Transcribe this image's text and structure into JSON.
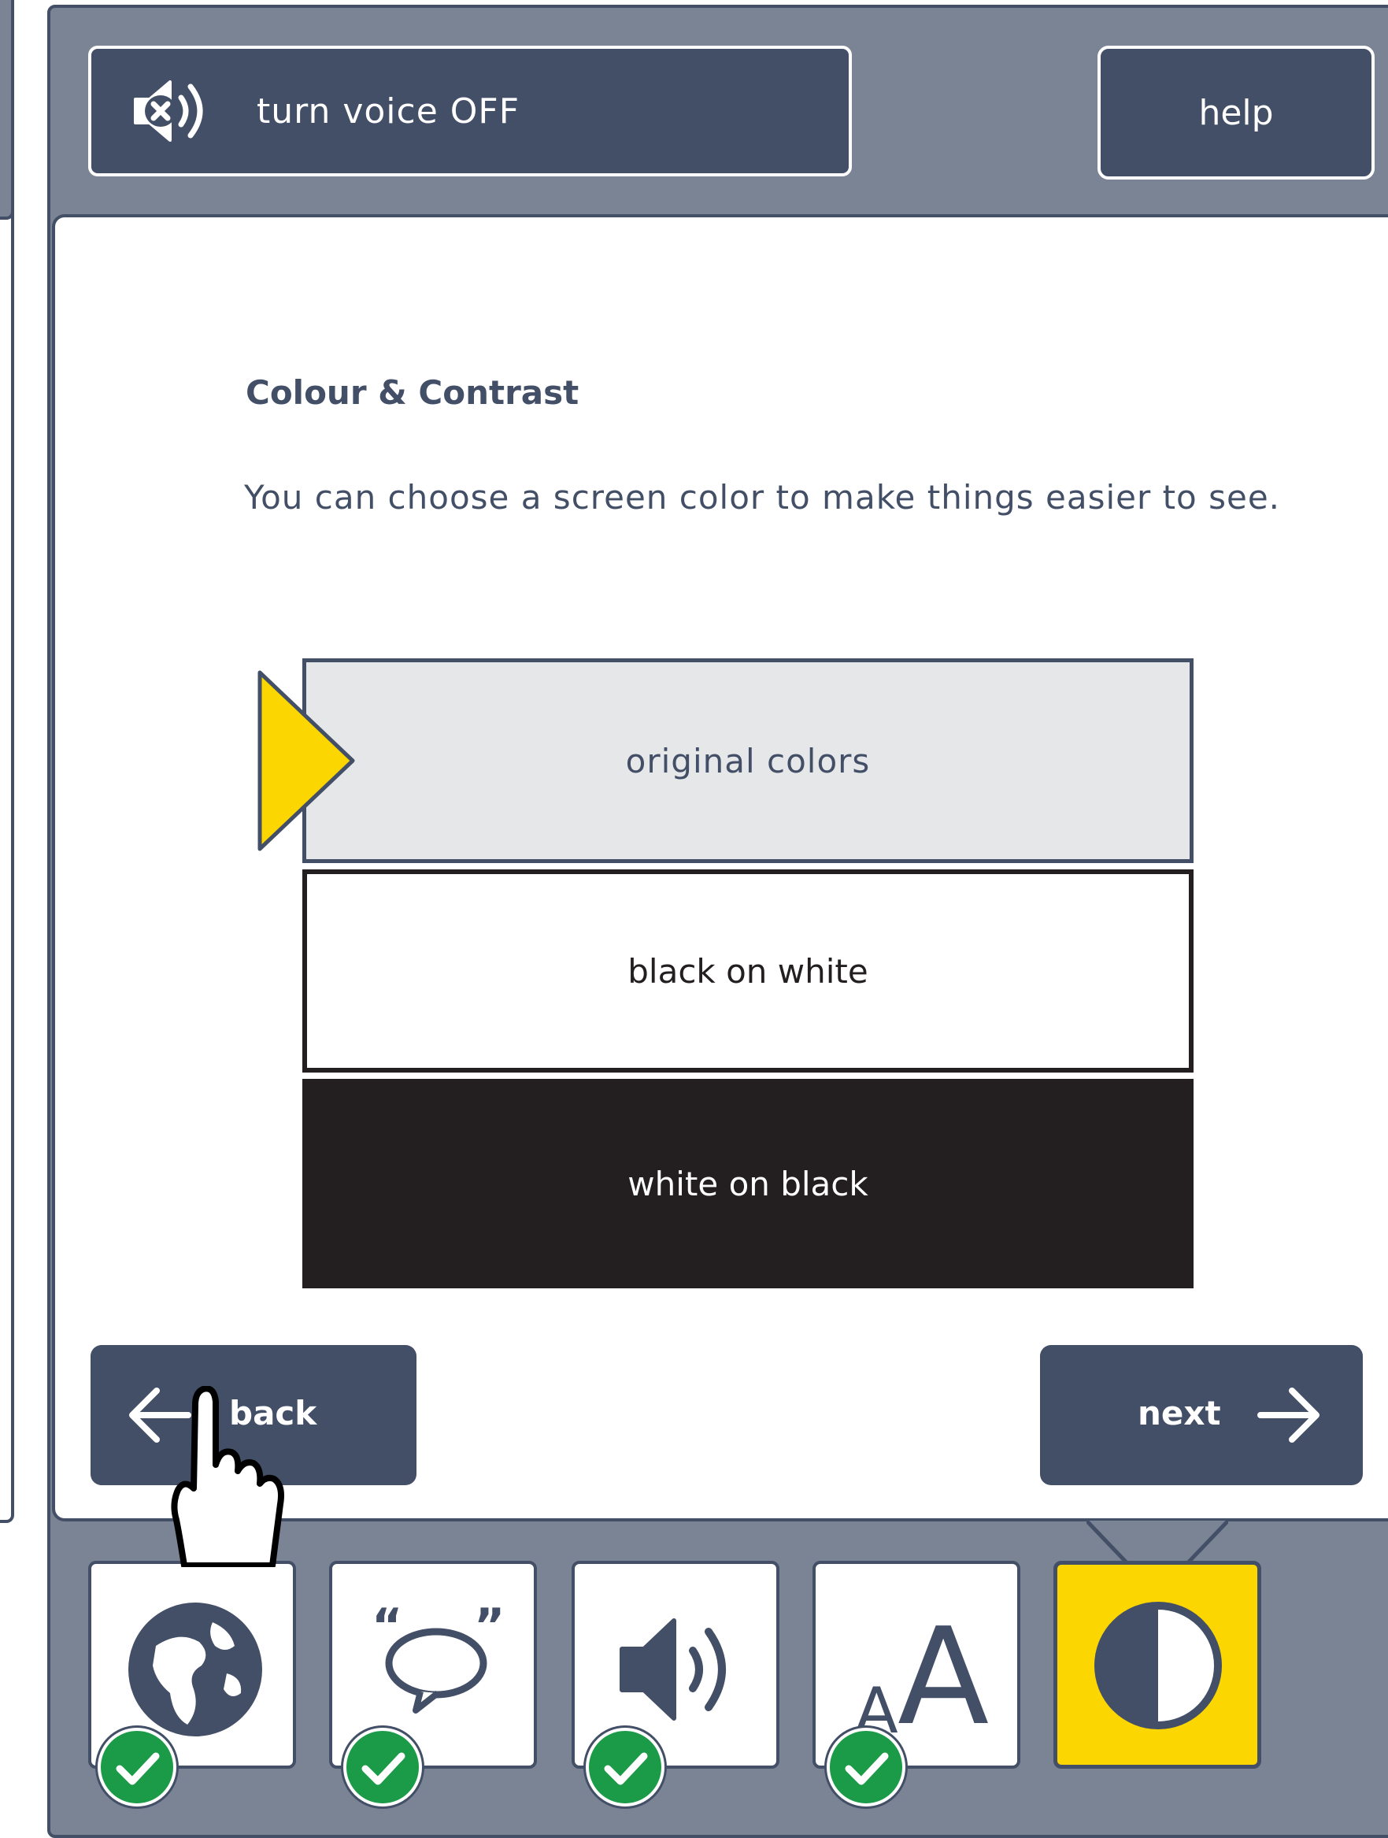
{
  "header": {
    "voice_button_label": "turn voice OFF",
    "help_button_label": "help"
  },
  "main": {
    "heading": "Colour & Contrast",
    "description": "You can choose a screen color to make things easier to see.",
    "options": [
      {
        "label": "original colors",
        "selected": true
      },
      {
        "label": "black on white",
        "selected": false
      },
      {
        "label": "white on black",
        "selected": false
      }
    ]
  },
  "navigation": {
    "back_label": "back",
    "next_label": "next"
  },
  "tabs": [
    {
      "icon": "globe-icon",
      "completed": true,
      "active": false
    },
    {
      "icon": "speech-bubble-icon",
      "completed": true,
      "active": false
    },
    {
      "icon": "speaker-icon",
      "completed": true,
      "active": false
    },
    {
      "icon": "text-size-icon",
      "completed": true,
      "active": false
    },
    {
      "icon": "contrast-icon",
      "completed": false,
      "active": true
    }
  ],
  "colors": {
    "panel_bg": "#7b8494",
    "primary": "#434f67",
    "accent": "#fcd600",
    "success": "#1b9a47",
    "dark": "#231f20"
  }
}
